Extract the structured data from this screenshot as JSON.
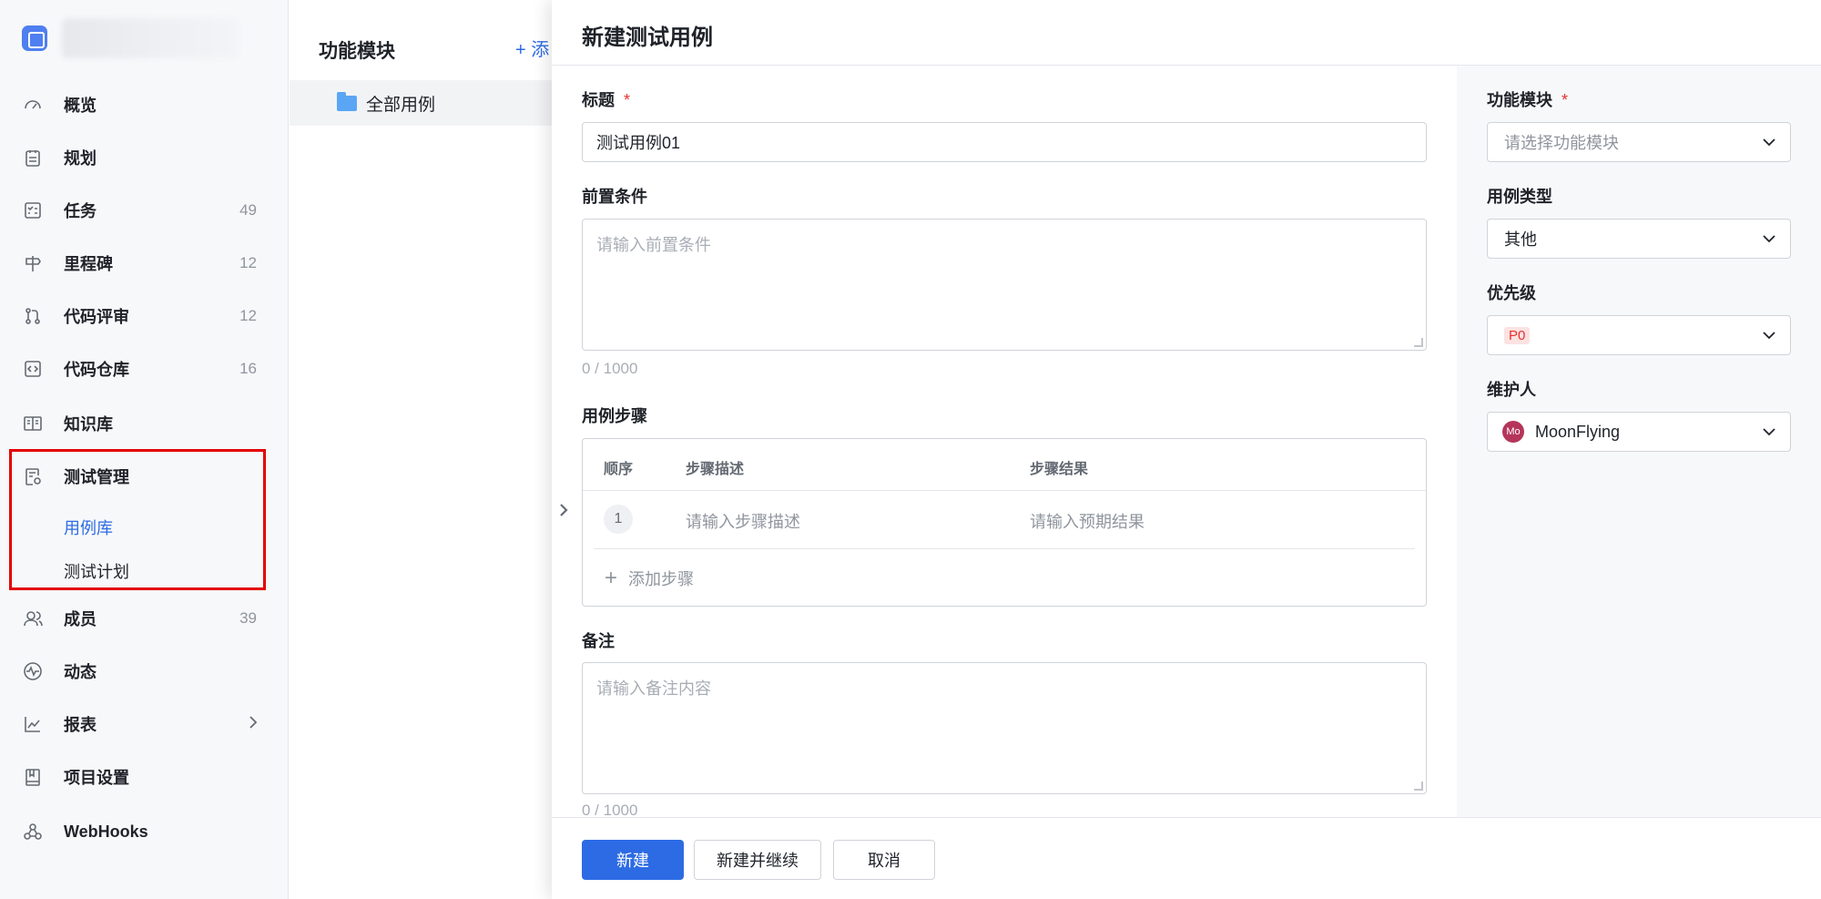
{
  "sidebar": {
    "items": [
      {
        "label": "概览",
        "icon": "dashboard-icon",
        "count": ""
      },
      {
        "label": "规划",
        "icon": "clipboard-icon",
        "count": ""
      },
      {
        "label": "任务",
        "icon": "task-list-icon",
        "count": "49"
      },
      {
        "label": "里程碑",
        "icon": "signpost-icon",
        "count": "12"
      },
      {
        "label": "代码评审",
        "icon": "git-pull-request-icon",
        "count": "12"
      },
      {
        "label": "代码仓库",
        "icon": "code-repo-icon",
        "count": "16"
      },
      {
        "label": "知识库",
        "icon": "book-icon",
        "count": ""
      },
      {
        "label": "测试管理",
        "icon": "test-doc-icon",
        "count": ""
      },
      {
        "label": "成员",
        "icon": "users-icon",
        "count": "39"
      },
      {
        "label": "动态",
        "icon": "activity-icon",
        "count": ""
      },
      {
        "label": "报表",
        "icon": "chart-icon",
        "count": ""
      },
      {
        "label": "项目设置",
        "icon": "settings-book-icon",
        "count": ""
      },
      {
        "label": "WebHooks",
        "icon": "webhook-icon",
        "count": ""
      }
    ],
    "sub_items": {
      "case_library": "用例库",
      "test_plan": "测试计划"
    }
  },
  "module_panel": {
    "title": "功能模块",
    "add_label": "+ 添",
    "folder_label": "全部用例"
  },
  "drawer": {
    "title": "新建测试用例",
    "title_field": {
      "label": "标题",
      "required": "*",
      "value": "测试用例01"
    },
    "precondition": {
      "label": "前置条件",
      "placeholder": "请输入前置条件",
      "counter": "0 / 1000"
    },
    "steps": {
      "label": "用例步骤",
      "headers": [
        "顺序",
        "步骤描述",
        "步骤结果"
      ],
      "rows": [
        {
          "order": "1",
          "desc_placeholder": "请输入步骤描述",
          "result_placeholder": "请输入预期结果"
        }
      ],
      "add_label": "添加步骤"
    },
    "remark": {
      "label": "备注",
      "placeholder": "请输入备注内容",
      "counter": "0 / 1000"
    },
    "side": {
      "module": {
        "label": "功能模块",
        "required": "*",
        "placeholder": "请选择功能模块"
      },
      "case_type": {
        "label": "用例类型",
        "value": "其他"
      },
      "priority": {
        "label": "优先级",
        "value": "P0"
      },
      "maintainer": {
        "label": "维护人",
        "avatar_text": "Mo",
        "value": "MoonFlying"
      }
    },
    "footer": {
      "create": "新建",
      "create_continue": "新建并继续",
      "cancel": "取消"
    }
  },
  "colors": {
    "accent": "#2d6be4",
    "highlight_border": "#e30000",
    "required": "#e5322e"
  }
}
